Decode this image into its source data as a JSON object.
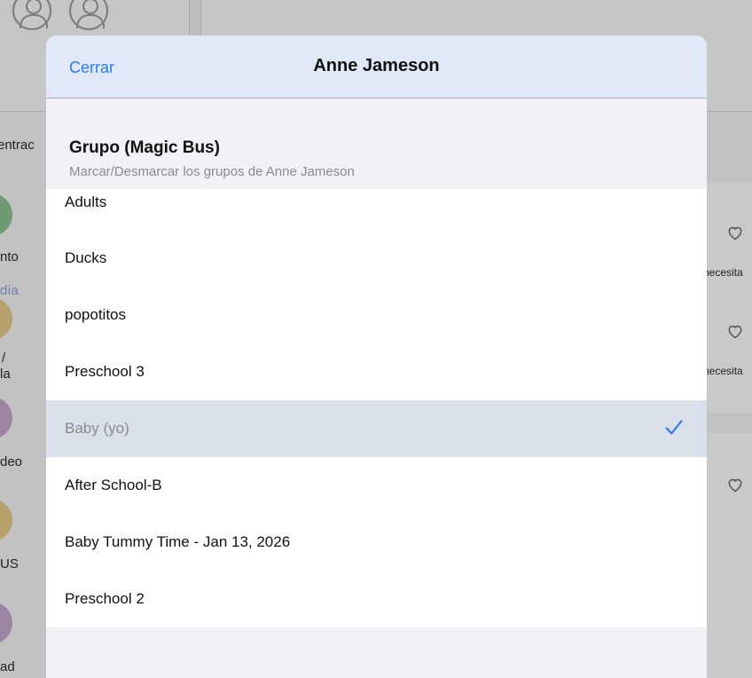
{
  "background": {
    "entrance_text": "entrac",
    "labels": [
      "nto",
      "día",
      "/",
      "la",
      "deo",
      "US",
      "ad"
    ],
    "right_text": [
      "necesita",
      "necesita"
    ]
  },
  "modal": {
    "close_label": "Cerrar",
    "title": "Anne Jameson",
    "section_title": "Grupo (Magic Bus)",
    "section_subtitle": "Marcar/Desmarcar los grupos de Anne Jameson",
    "groups": [
      {
        "label": "Adults",
        "checked": false
      },
      {
        "label": "Ducks",
        "checked": false
      },
      {
        "label": "popotitos",
        "checked": false
      },
      {
        "label": "Preschool 3",
        "checked": false
      },
      {
        "label": "Baby (yo)",
        "checked": true
      },
      {
        "label": "After School-B",
        "checked": false
      },
      {
        "label": "Baby Tummy Time - Jan 13, 2026",
        "checked": false
      },
      {
        "label": "Preschool 2",
        "checked": false
      }
    ]
  },
  "colors": {
    "accent": "#2f7bf2",
    "header_bg": "#e1e8f8",
    "selected_row": "#d9dfeb"
  }
}
